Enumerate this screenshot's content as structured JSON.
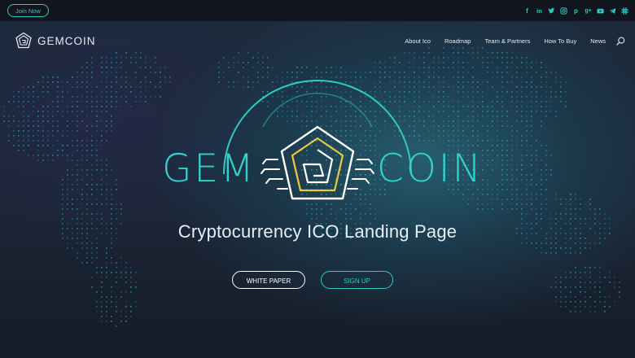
{
  "topbar": {
    "join_label": "Join Now",
    "social_icons": [
      "facebook-icon",
      "linkedin-icon",
      "twitter-icon",
      "instagram-icon",
      "pinterest-icon",
      "googleplus-icon",
      "youtube-icon",
      "telegram-icon",
      "slack-icon"
    ]
  },
  "nav": {
    "brand": "GEMCOIN",
    "items": [
      {
        "label": "About Ico"
      },
      {
        "label": "Roadmap"
      },
      {
        "label": "Team & Partners"
      },
      {
        "label": "How To Buy"
      },
      {
        "label": "News"
      }
    ]
  },
  "hero": {
    "logo_left": "GEM",
    "logo_right": "COIN",
    "tagline": "Cryptocurrency ICO Landing Page",
    "primary_button": "WHITE PAPER",
    "secondary_button": "SIGN UP"
  },
  "colors": {
    "accent_teal": "#2fc9c0",
    "accent_yellow": "#e9c842",
    "background": "#1a2230",
    "topbar": "#11161e"
  }
}
